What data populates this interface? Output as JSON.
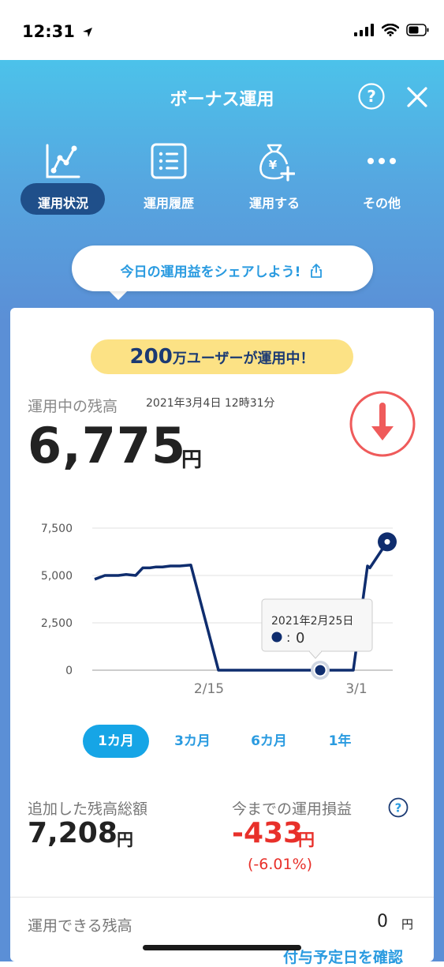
{
  "status_bar": {
    "time": "12:31"
  },
  "header": {
    "title": "ボーナス運用"
  },
  "nav": {
    "items": [
      {
        "label": "運用状況",
        "icon": "line-chart-icon",
        "active": true
      },
      {
        "label": "運用履歴",
        "icon": "list-icon",
        "active": false
      },
      {
        "label": "運用する",
        "icon": "money-bag-plus-icon",
        "active": false
      },
      {
        "label": "その他",
        "icon": "more-dots-icon",
        "active": false
      }
    ]
  },
  "share": {
    "text": "今日の運用益をシェアしよう!"
  },
  "badge": {
    "count": "200",
    "text": "万ユーザーが運用中！"
  },
  "balance": {
    "label": "運用中の残高",
    "datetime": "2021年3月4日 12時31分",
    "amount": "6,775",
    "unit": "円"
  },
  "chart_data": {
    "type": "line",
    "y_ticks": [
      "7,500",
      "5,000",
      "2,500",
      "0"
    ],
    "x_ticks": [
      "2/15",
      "3/1"
    ],
    "ylim": [
      0,
      7500
    ],
    "series": [
      {
        "values": [
          4800,
          5000,
          5000,
          5000,
          5050,
          5000,
          5400,
          5400,
          5450,
          5450,
          5500,
          5500,
          5550,
          0,
          0,
          0,
          0,
          0,
          0,
          0,
          0,
          0,
          0,
          0,
          5500,
          5400,
          6775
        ]
      }
    ],
    "tooltip": {
      "date": "2021年2月25日",
      "value": "0"
    },
    "color": "#0f2d6e"
  },
  "periods": {
    "items": [
      "1カ月",
      "3カ月",
      "6カ月",
      "1年"
    ],
    "selected": 0
  },
  "stats": {
    "added": {
      "label": "追加した残高総額",
      "value": "7,208",
      "unit": "円"
    },
    "pnl": {
      "label": "今までの運用損益",
      "value": "-433",
      "unit": "円",
      "percent": "(-6.01%)"
    }
  },
  "available": {
    "label": "運用できる残高",
    "value": "0",
    "unit": "円"
  },
  "link": {
    "text": "付与予定日を確認"
  },
  "colors": {
    "accent": "#2a9be0",
    "navy": "#1b3a73",
    "loss": "#e8302a",
    "down_icon": "#ef5b5b"
  }
}
